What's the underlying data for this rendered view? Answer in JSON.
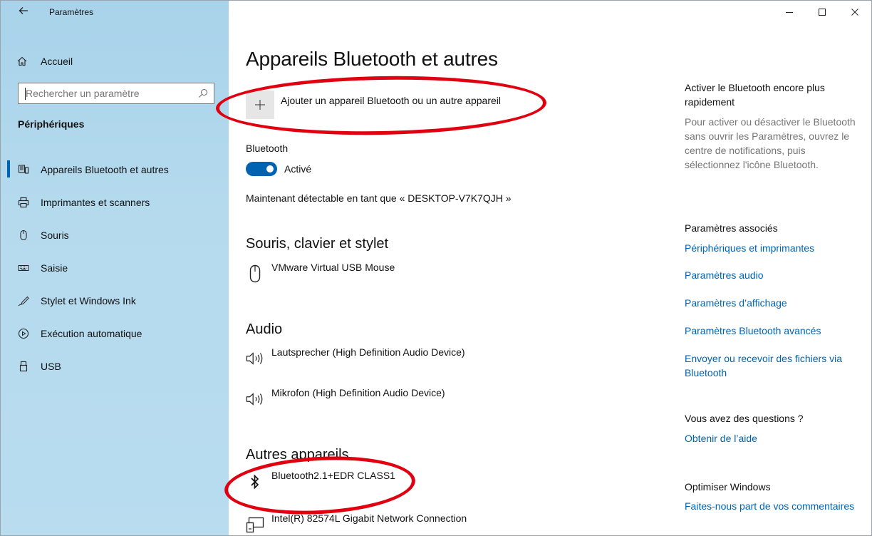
{
  "window": {
    "title": "Paramètres"
  },
  "sidebar": {
    "home_label": "Accueil",
    "search_placeholder": "Rechercher un paramètre",
    "section_title": "Périphériques",
    "items": [
      {
        "label": "Appareils Bluetooth et autres",
        "icon": "bluetooth-devices-icon",
        "active": true
      },
      {
        "label": "Imprimantes et scanners",
        "icon": "printer-icon",
        "active": false
      },
      {
        "label": "Souris",
        "icon": "mouse-icon",
        "active": false
      },
      {
        "label": "Saisie",
        "icon": "keyboard-icon",
        "active": false
      },
      {
        "label": "Stylet et Windows Ink",
        "icon": "pen-icon",
        "active": false
      },
      {
        "label": "Exécution automatique",
        "icon": "autoplay-icon",
        "active": false
      },
      {
        "label": "USB",
        "icon": "usb-icon",
        "active": false
      }
    ]
  },
  "main": {
    "page_title": "Appareils Bluetooth et autres",
    "add_device_label": "Ajouter un appareil Bluetooth ou un autre appareil",
    "bluetooth_label": "Bluetooth",
    "bluetooth_state": "Activé",
    "discoverable_text": "Maintenant détectable en tant que « DESKTOP-V7K7QJH »",
    "groups": {
      "mouse": {
        "title": "Souris, clavier et stylet",
        "devices": [
          {
            "name": "VMware Virtual USB Mouse",
            "icon": "mouse-icon"
          }
        ]
      },
      "audio": {
        "title": "Audio",
        "devices": [
          {
            "name": "Lautsprecher (High Definition Audio Device)",
            "icon": "speaker-icon"
          },
          {
            "name": "Mikrofon (High Definition Audio Device)",
            "icon": "speaker-icon"
          }
        ]
      },
      "other": {
        "title": "Autres appareils",
        "devices": [
          {
            "name": "Bluetooth2.1+EDR CLASS1",
            "icon": "bluetooth-icon"
          },
          {
            "name": "Intel(R) 82574L Gigabit Network Connection",
            "icon": "network-icon"
          }
        ]
      }
    }
  },
  "side": {
    "quick_title": "Activer le Bluetooth encore plus rapidement",
    "quick_desc": "Pour activer ou désactiver le Bluetooth sans ouvrir les Paramètres, ouvrez le centre de notifications, puis sélectionnez l'icône Bluetooth.",
    "related_title": "Paramètres associés",
    "related_links": [
      "Périphériques et imprimantes",
      "Paramètres audio",
      "Paramètres d’affichage",
      "Paramètres Bluetooth avancés",
      "Envoyer ou recevoir des fichiers via Bluetooth"
    ],
    "questions_title": "Vous avez des questions ?",
    "help_link": "Obtenir de l’aide",
    "improve_title": "Optimiser Windows",
    "feedback_link": "Faites-nous part de vos commentaires"
  },
  "colors": {
    "accent": "#0063b1",
    "annotation": "#e0000f",
    "sidebar_bg": "#b5daee"
  }
}
